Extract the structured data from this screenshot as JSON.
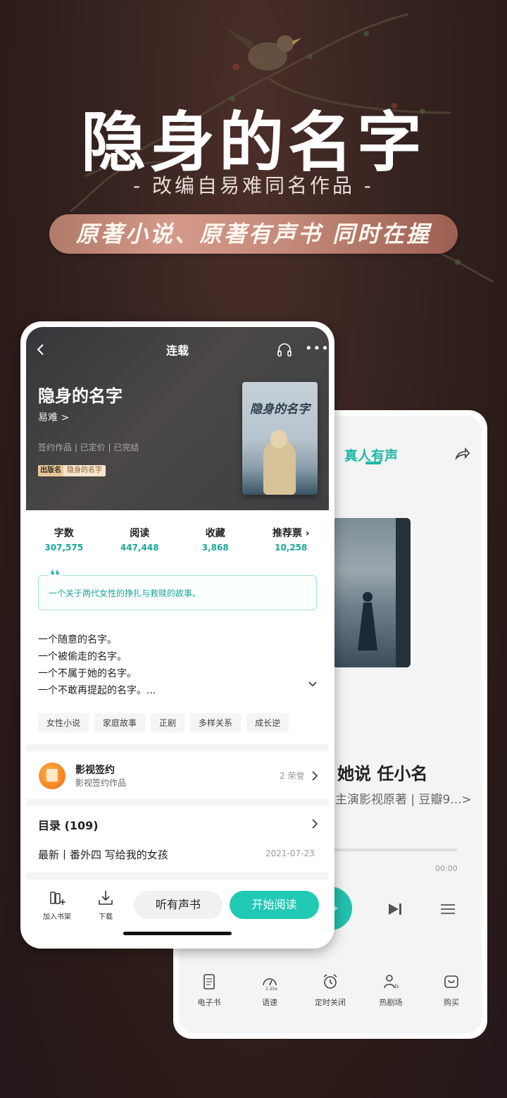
{
  "hero": {
    "title": "隐身的名字",
    "subtitle": "- 改编自易难同名作品 -",
    "banner": "原著小说、原著有声书 同时在握"
  },
  "audio_screen": {
    "title": "真人有声",
    "song_name": "她说 任小名",
    "song_desc": "主演影视原著 | 豆瓣9...>",
    "time": "00:00",
    "tools": [
      {
        "label": "电子书",
        "icon": "ebook-icon"
      },
      {
        "label": "语速",
        "icon": "speed-icon"
      },
      {
        "label": "定时关闭",
        "icon": "alarm-clock-icon"
      },
      {
        "label": "热剧场",
        "icon": "theater-icon"
      },
      {
        "label": "购买",
        "icon": "shopping-bag-icon"
      }
    ]
  },
  "book_screen": {
    "nav_title": "连载",
    "book_title": "隐身的名字",
    "author": "易难 >",
    "meta": "签约作品  |  已定价  |  已完结",
    "badge_tag": "出版名",
    "badge_name": "隐身的名字",
    "cover_title": "隐身的名字",
    "stats": [
      {
        "label": "字数",
        "value": "307,575"
      },
      {
        "label": "阅读",
        "value": "447,448"
      },
      {
        "label": "收藏",
        "value": "3,868"
      },
      {
        "label": "推荐票 ›",
        "value": "10,258"
      }
    ],
    "quote_mark": "❛❛",
    "quote": "一个关于两代女性的挣扎与救赎的故事。",
    "intro_lines": [
      "一个随意的名字。",
      "一个被偷走的名字。",
      "一个不属于她的名字。",
      "一个不敢再提起的名字。..."
    ],
    "tags": [
      "女性小说",
      "家庭故事",
      "正剧",
      "多样关系",
      "成长逆"
    ],
    "film": {
      "title": "影视签约",
      "subtitle": "影视签约作品",
      "honor": "2 荣誉"
    },
    "toc_label": "目录 (109)",
    "latest_chapter": "最新丨番外四 写给我的女孩",
    "latest_date": "2021-07-23",
    "bottom": {
      "add_shelf": "加入书架",
      "download": "下载",
      "listen": "听有声书",
      "start_read": "开始阅读"
    }
  },
  "colors": {
    "accent": "#22c9b4",
    "banner": "#c38878",
    "background": "#2c1d1b"
  }
}
